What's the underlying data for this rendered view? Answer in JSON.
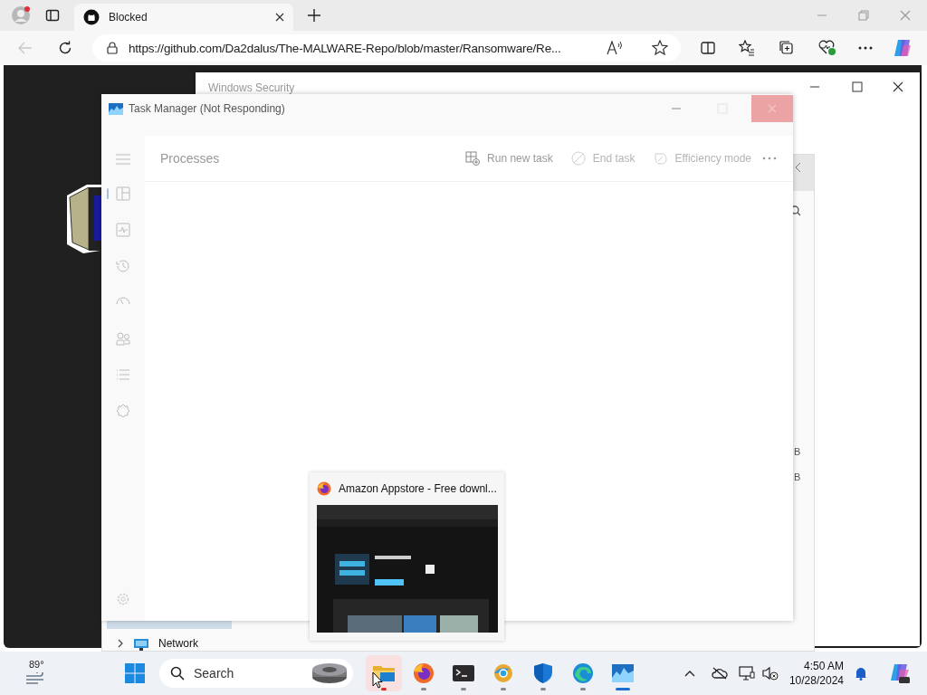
{
  "browser": {
    "tab": {
      "title": "Blocked"
    },
    "address": {
      "url": "https://github.com/Da2dalus/The-MALWARE-Repo/blob/master/Ransomware/Re..."
    }
  },
  "windows_security": {
    "title": "Windows Security"
  },
  "file_explorer": {
    "column_texts": [
      "B",
      "B"
    ],
    "tree_item": {
      "label": "Network",
      "expanded": false
    }
  },
  "task_manager": {
    "title": "Task Manager (Not Responding)",
    "nav": [
      {
        "kind": "processes",
        "selected": true
      },
      {
        "kind": "performance",
        "selected": false
      },
      {
        "kind": "history",
        "selected": false
      },
      {
        "kind": "startup",
        "selected": false
      },
      {
        "kind": "users",
        "selected": false
      },
      {
        "kind": "details",
        "selected": false
      },
      {
        "kind": "services",
        "selected": false
      }
    ],
    "page_title": "Processes",
    "toolbar": [
      {
        "kind": "run",
        "label": "Run new task",
        "disabled": false
      },
      {
        "kind": "end",
        "label": "End task",
        "disabled": true
      },
      {
        "kind": "efficiency",
        "label": "Efficiency mode",
        "disabled": true
      }
    ]
  },
  "thumbnail": {
    "title": "Amazon Appstore - Free downl..."
  },
  "taskbar": {
    "weather": "89°",
    "search": {
      "placeholder": "Search"
    },
    "apps": [
      {
        "kind": "files",
        "needs_attention": true,
        "active": false,
        "hovered": true
      },
      {
        "kind": "firefox",
        "needs_attention": false,
        "active": false,
        "hovered": false
      },
      {
        "kind": "terminal",
        "needs_attention": false,
        "active": false,
        "hovered": false
      },
      {
        "kind": "chrome",
        "needs_attention": false,
        "active": false,
        "hovered": false
      },
      {
        "kind": "defender",
        "needs_attention": false,
        "active": false,
        "hovered": false
      },
      {
        "kind": "edge",
        "needs_attention": false,
        "active": false,
        "hovered": false
      },
      {
        "kind": "taskmgr",
        "needs_attention": false,
        "active": true,
        "hovered": false
      }
    ],
    "time": "4:50 AM",
    "date": "10/28/2024"
  }
}
